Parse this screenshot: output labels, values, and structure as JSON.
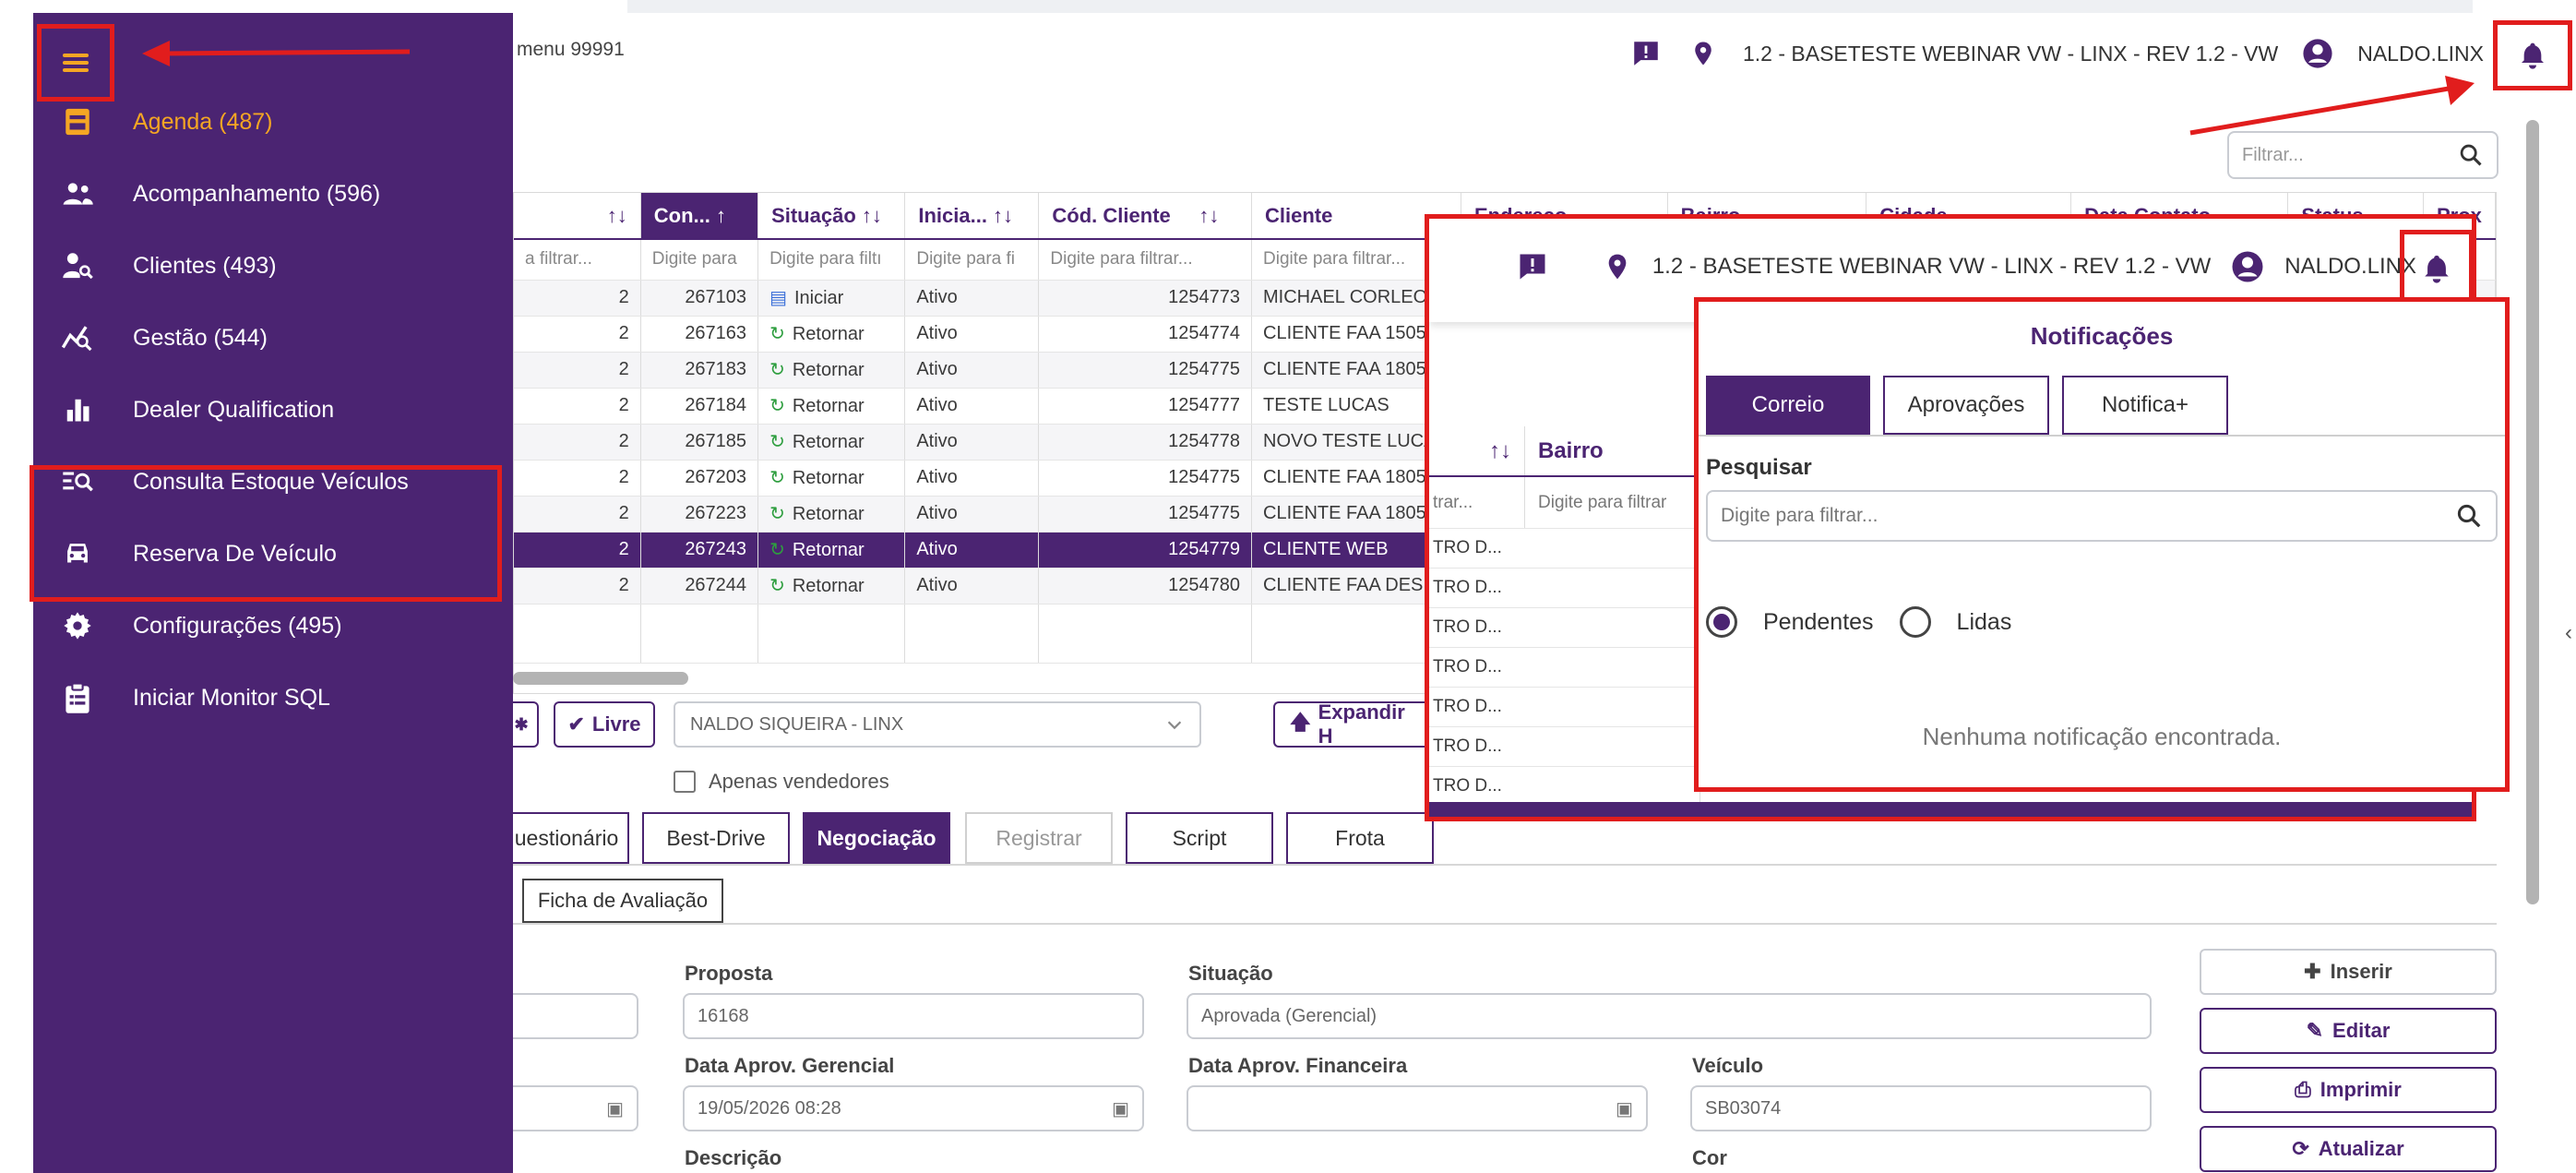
{
  "topbar": {
    "menu_text": "menu 99991",
    "location": "1.2 - BASETESTE WEBINAR VW - LINX - REV 1.2 - VW",
    "user": "NALDO.LINX",
    "filter_placeholder": "Filtrar..."
  },
  "sidebar": {
    "items": [
      {
        "label": "Agenda (487)",
        "icon": "calendar-badge-icon"
      },
      {
        "label": "Acompanhamento (596)",
        "icon": "users-icon"
      },
      {
        "label": "Clientes (493)",
        "icon": "user-search-icon"
      },
      {
        "label": "Gestão (544)",
        "icon": "chart-search-icon"
      },
      {
        "label": "Dealer Qualification",
        "icon": "bar-chart-icon"
      },
      {
        "label": "Consulta Estoque Veículos",
        "icon": "list-search-icon"
      },
      {
        "label": "Reserva De Veículo",
        "icon": "car-icon"
      },
      {
        "label": "Configurações (495)",
        "icon": "gear-icon"
      },
      {
        "label": "Iniciar Monitor SQL",
        "icon": "clipboard-icon"
      }
    ],
    "active_color": "#f5a623"
  },
  "grid": {
    "headers": [
      "Con...",
      "Situação",
      "Inicia...",
      "Cód. Cliente",
      "Cliente",
      "Endereço",
      "Bairro",
      "Cidade",
      "Data Contato",
      "Status",
      "Prox"
    ],
    "filters": [
      "a filtrar...",
      "Digite para",
      "Digite para filtı",
      "Digite para fi",
      "Digite para filtrar...",
      "Digite para filtrar..."
    ],
    "rows": [
      {
        "c0": "2",
        "con": "267103",
        "sit": "Iniciar",
        "ini": "Ativo",
        "cod": "1254773",
        "cli": "MICHAEL CORLEO"
      },
      {
        "c0": "2",
        "con": "267163",
        "sit": "Retornar",
        "ini": "Ativo",
        "cod": "1254774",
        "cli": "CLIENTE FAA 1505"
      },
      {
        "c0": "2",
        "con": "267183",
        "sit": "Retornar",
        "ini": "Ativo",
        "cod": "1254775",
        "cli": "CLIENTE FAA 1805"
      },
      {
        "c0": "2",
        "con": "267184",
        "sit": "Retornar",
        "ini": "Ativo",
        "cod": "1254777",
        "cli": "TESTE LUCAS"
      },
      {
        "c0": "2",
        "con": "267185",
        "sit": "Retornar",
        "ini": "Ativo",
        "cod": "1254778",
        "cli": "NOVO TESTE LUCA"
      },
      {
        "c0": "2",
        "con": "267203",
        "sit": "Retornar",
        "ini": "Ativo",
        "cod": "1254775",
        "cli": "CLIENTE FAA 1805"
      },
      {
        "c0": "2",
        "con": "267223",
        "sit": "Retornar",
        "ini": "Ativo",
        "cod": "1254775",
        "cli": "CLIENTE FAA 1805"
      },
      {
        "c0": "2",
        "con": "267243",
        "sit": "Retornar",
        "ini": "Ativo",
        "cod": "1254779",
        "cli": "CLIENTE WEB"
      },
      {
        "c0": "2",
        "con": "267244",
        "sit": "Retornar",
        "ini": "Ativo",
        "cod": "1254780",
        "cli": "CLIENTE FAA DESK"
      }
    ]
  },
  "controls": {
    "livre": "Livre",
    "vendedor": "NALDO SIQUEIRA - LINX",
    "expandir": "Expandir H",
    "apenas_vendedores": "Apenas vendedores"
  },
  "tabs": [
    "uestionário",
    "Best-Drive",
    "Negociação",
    "Registrar",
    "Script",
    "Frota"
  ],
  "subtab": "Ficha de Avaliação",
  "form": {
    "proposta_label": "Proposta",
    "proposta_value": "16168",
    "situacao_label": "Situação",
    "situacao_value": "Aprovada (Gerencial)",
    "data_aprov_ger_label": "Data Aprov. Gerencial",
    "data_aprov_ger_value": "19/05/2026 08:28",
    "data_aprov_fin_label": "Data Aprov. Financeira",
    "data_aprov_fin_value": "",
    "veiculo_label": "Veículo",
    "veiculo_value": "SB03074",
    "descricao_label": "Descrição",
    "cor_label": "Cor"
  },
  "actions": [
    "Inserir",
    "Editar",
    "Imprimir",
    "Atualizar"
  ],
  "popup": {
    "location": "1.2 - BASETESTE WEBINAR VW - LINX - REV 1.2 - VW",
    "user": "NALDO.LINX",
    "grid_header": "Bairro",
    "grid_filter_left": "trar...",
    "grid_filter": "Digite para filtrar",
    "grid_rows": [
      "TRO D...",
      "TRO D...",
      "TRO D...",
      "TRO D...",
      "TRO D...",
      "TRO D...",
      "TRO D..."
    ]
  },
  "notifications": {
    "title": "Notificações",
    "tabs": [
      "Correio",
      "Aprovações",
      "Notifica+"
    ],
    "search_label": "Pesquisar",
    "search_placeholder": "Digite para filtrar...",
    "radio_pending": "Pendentes",
    "radio_read": "Lidas",
    "empty": "Nenhuma notificação encontrada."
  },
  "colors": {
    "brand": "#4b2472",
    "accent": "#f5a623",
    "highlight": "#e11d1d"
  }
}
